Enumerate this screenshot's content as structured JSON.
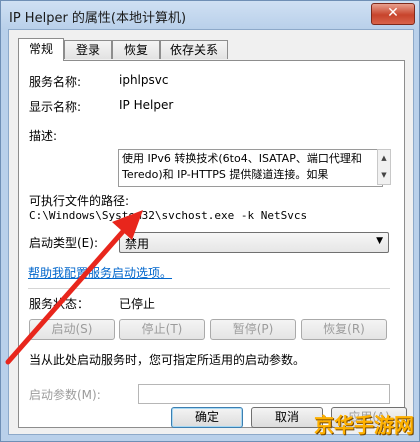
{
  "window": {
    "title": "IP Helper 的属性(本地计算机)",
    "close_glyph": "✕"
  },
  "tabs": [
    {
      "label": "常规",
      "active": true
    },
    {
      "label": "登录",
      "active": false
    },
    {
      "label": "恢复",
      "active": false
    },
    {
      "label": "依存关系",
      "active": false
    }
  ],
  "general": {
    "service_name_label": "服务名称:",
    "service_name_value": "iphlpsvc",
    "display_name_label": "显示名称:",
    "display_name_value": "IP Helper",
    "description_label": "描述:",
    "description_value": "使用 IPv6 转换技术(6to4、ISATAP、端口代理和 Teredo)和 IP-HTTPS 提供隧道连接。如果",
    "exe_path_label": "可执行文件的路径:",
    "exe_path_value": "C:\\Windows\\System32\\svchost.exe -k NetSvcs",
    "startup_type_label": "启动类型(E):",
    "startup_type_value": "禁用",
    "help_link": "帮助我配置服务启动选项。",
    "status_label": "服务状态：",
    "status_value": "已停止",
    "buttons": {
      "start": "启动(S)",
      "stop": "停止(T)",
      "pause": "暂停(P)",
      "resume": "恢复(R)"
    },
    "hint": "当从此处启动服务时，您可指定所适用的启动参数。",
    "params_label": "启动参数(M):",
    "params_value": ""
  },
  "footer": {
    "ok": "确定",
    "cancel": "取消",
    "apply": "应用(A)"
  },
  "watermark": "京华手游网",
  "colors": {
    "arrow": "#e8261c",
    "link": "#0066cc",
    "close": "#c7442c"
  }
}
